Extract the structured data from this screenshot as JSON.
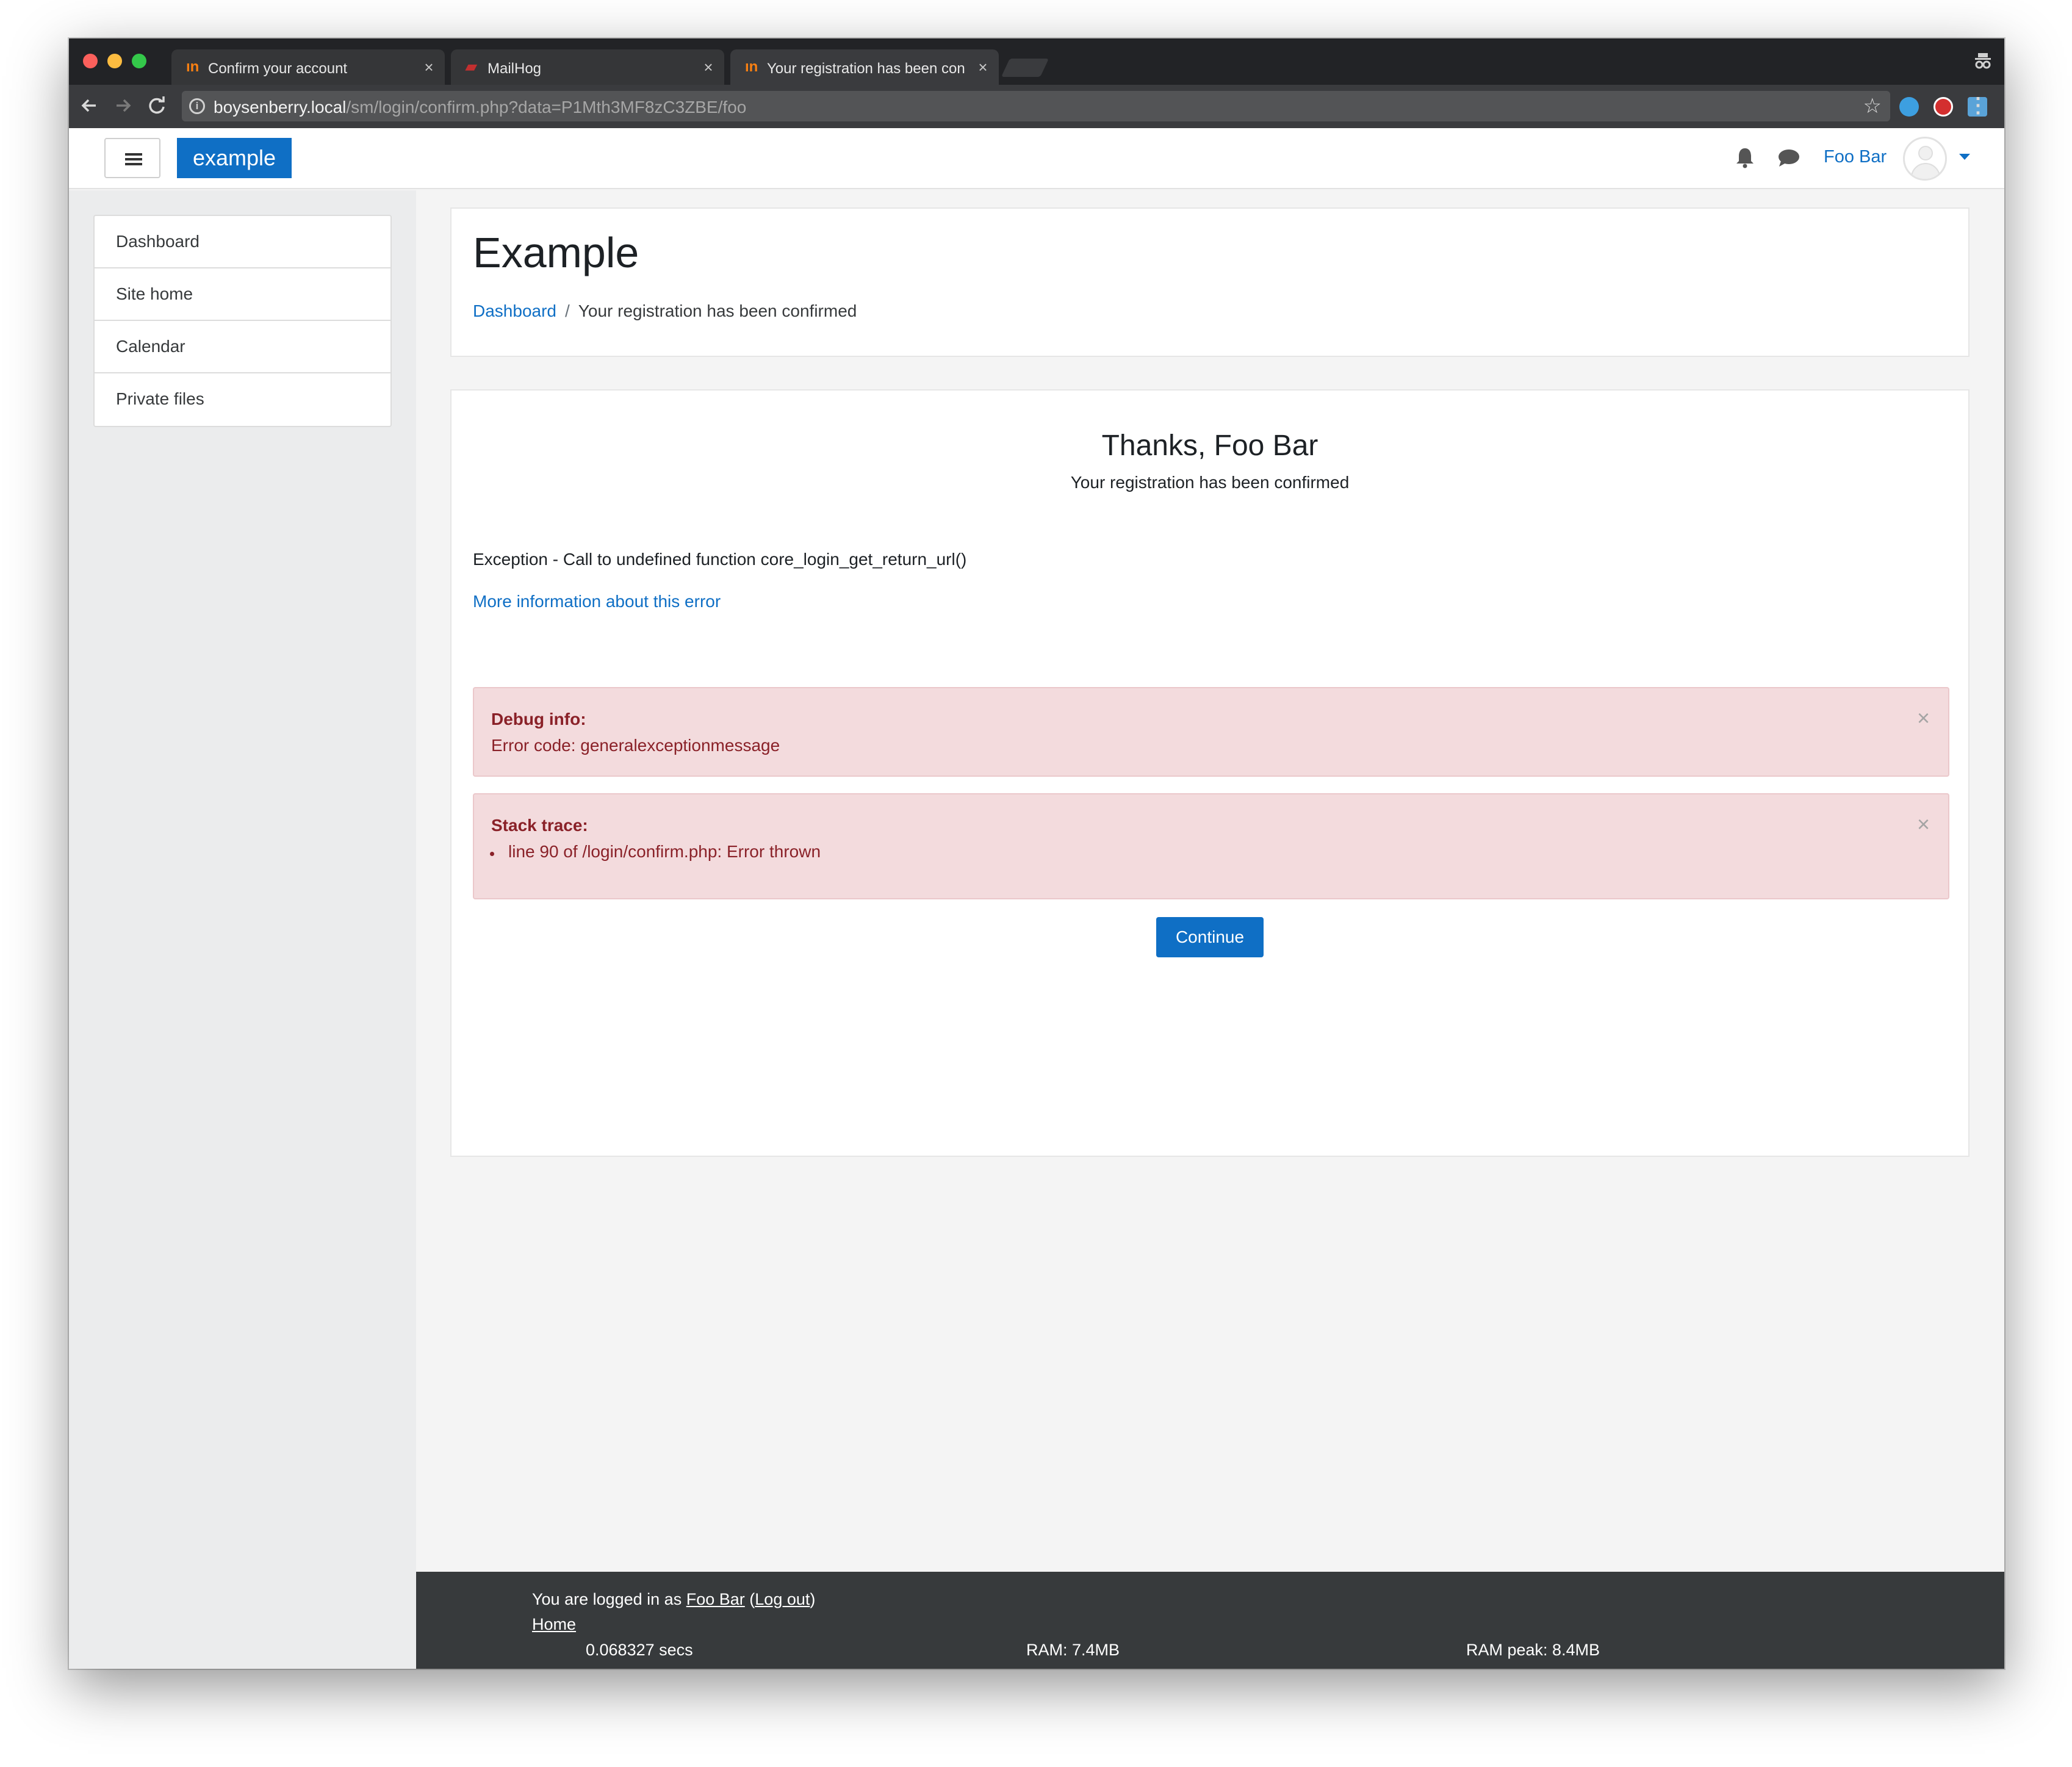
{
  "browser": {
    "tabs": [
      {
        "label": "Confirm your account",
        "favicon": "moodle-icon",
        "active": false
      },
      {
        "label": "MailHog",
        "favicon": "mailhog-icon",
        "active": false
      },
      {
        "label": "Your registration has been con",
        "favicon": "moodle-icon",
        "active": true
      }
    ],
    "url_host": "boysenberry.local",
    "url_path": "/sm/login/confirm.php?data=P1Mth3MF8zC3ZBE/foo",
    "close_glyph": "×"
  },
  "navbar": {
    "brand": "example",
    "user_name": "Foo Bar"
  },
  "sidebar": {
    "items": [
      {
        "label": "Dashboard"
      },
      {
        "label": "Site home"
      },
      {
        "label": "Calendar"
      },
      {
        "label": "Private files"
      }
    ]
  },
  "header": {
    "title": "Example",
    "breadcrumb_link": "Dashboard",
    "breadcrumb_sep": "/",
    "breadcrumb_current": "Your registration has been confirmed"
  },
  "main": {
    "thanks": "Thanks, Foo Bar",
    "confirmed": "Your registration has been confirmed",
    "exception": "Exception - Call to undefined function core_login_get_return_url()",
    "more_info": "More information about this error",
    "debug_title": "Debug info:",
    "debug_body": "Error code: generalexceptionmessage",
    "stack_title": "Stack trace:",
    "stack_item": "line 90 of /login/confirm.php: Error thrown",
    "continue": "Continue"
  },
  "footer": {
    "logged_prefix": "You are logged in as",
    "user_link": "Foo Bar",
    "logout_open": "(",
    "logout_link": "Log out",
    "logout_close": ")",
    "home_link": "Home",
    "time": "0.068327 secs",
    "ram": "RAM: 7.4MB",
    "ram_peak": "RAM peak: 8.4MB"
  },
  "colors": {
    "accent": "#0f6fc5",
    "alert_bg": "#f3dbdd",
    "alert_text": "#8a2128",
    "footer_bg": "#373a3c"
  }
}
